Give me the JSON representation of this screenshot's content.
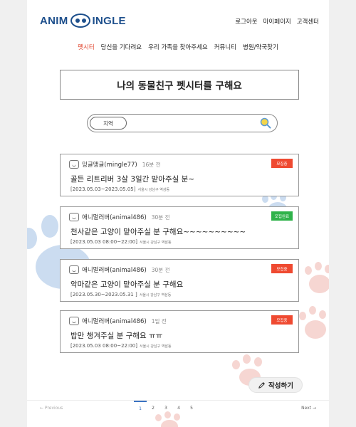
{
  "header": {
    "logo_text_left": "ANIM",
    "logo_text_right": "INGLE",
    "links": [
      "로그아웃",
      "마이페이지",
      "고객센터"
    ]
  },
  "nav": {
    "items": [
      "펫시터",
      "당신을 기다려요",
      "우리 가족을 찾아주세요",
      "커뮤니티",
      "병원/약국찾기"
    ],
    "active_index": 0
  },
  "title": "나의 동물친구 펫시터를 구해요",
  "search": {
    "region_label": "지역",
    "icon": "search-icon"
  },
  "posts": [
    {
      "author": "밍글맹글(mingle77)",
      "time": "16분 전",
      "title": "골든 리트리버 3살 3일간 맡아주실 분~",
      "period": "[2023.05.03~2023.05.05]",
      "location": "서울시 강남구 역삼동",
      "status": "모집중",
      "status_color": "#ef4a31"
    },
    {
      "author": "애니멀러버(animal486)",
      "time": "30분 전",
      "title": "천사같은 고양이 맡아주실 분 구해요~~~~~~~~~~",
      "period": "[2023.05.03 08:00~22:00]",
      "location": "서울시 강남구 역삼동",
      "status": "모집완료",
      "status_color": "#2fb24a"
    },
    {
      "author": "애니멀러버(animal486)",
      "time": "30분 전",
      "title": "악마같은 고양이 맡아주실 분 구해요",
      "period": "[2023.05.30~2023.05.31 ]",
      "location": "서울시 강남구 역삼동",
      "status": "모집중",
      "status_color": "#ef4a31"
    },
    {
      "author": "애니멀러버(animal486)",
      "time": "1일 전",
      "title": "밥만 챙겨주실 분 구해요 ㅠㅠ",
      "period": "[2023.05.03 08:00~22:00]",
      "location": "서울시 강남구 역삼동",
      "status": "모집중",
      "status_color": "#ef4a31"
    }
  ],
  "write_button": {
    "label": "작성하기",
    "icon": "pencil-icon"
  },
  "pagination": {
    "prev_label": "← Previous",
    "next_label": "Next →",
    "pages": [
      "1",
      "2",
      "3",
      "4",
      "5"
    ],
    "current": "1"
  },
  "colors": {
    "brand": "#1d4f8c",
    "active_nav": "#e0432c",
    "paw_blue": "#cbdcf0",
    "paw_pink": "#f6d6d2",
    "pagination_active": "#3a73c2"
  }
}
